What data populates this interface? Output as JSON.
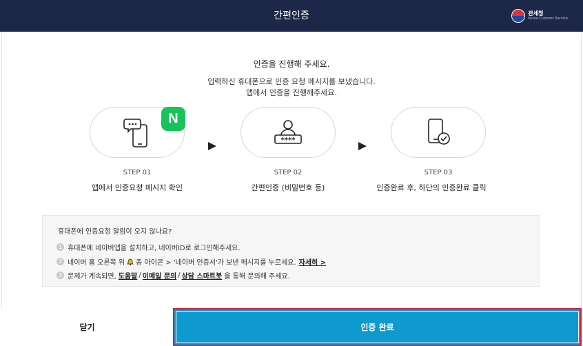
{
  "header": {
    "title": "간편인증",
    "logo_name": "관세청",
    "logo_sub": "Korea Customs Service"
  },
  "intro": {
    "title": "인증을 진행해 주세요.",
    "line1": "입력하신 휴대폰으로 인증 요청 메시지를 보냈습니다.",
    "line2": "앱에서 인증을 진행해주세요."
  },
  "steps": [
    {
      "label": "STEP 01",
      "desc": "앱에서 인증요청 메시지 확인",
      "icon": "phone-message-icon",
      "badge": "N"
    },
    {
      "label": "STEP 02",
      "desc": "간편인증 (비밀번호 등)",
      "icon": "user-password-icon"
    },
    {
      "label": "STEP 03",
      "desc": "인증완료 후, 하단의 인증완료 클릭",
      "icon": "phone-check-icon"
    }
  ],
  "help": {
    "title": "휴대폰에 인증요청 알림이 오지 않나요?",
    "row1": {
      "num": "1",
      "text": "휴대폰에 네이버앱을 설치하고, 네이버ID로 로그인해주세요."
    },
    "row2": {
      "num": "2",
      "text_a": "네이버 홈 오른쪽 위",
      "text_b": "종 아이콘 > '네이버 인증서'가 보낸 메시지를 누르세요.",
      "link": "자세히 >"
    },
    "row3": {
      "num": "3",
      "text_a": "문제가 계속되면,",
      "link1": "도움말",
      "sep1": "/",
      "link2": "이메일 문의",
      "sep2": "/",
      "link3": "상담 스마트봇",
      "text_b": "을 통해 문의해 주세요."
    }
  },
  "buttons": {
    "close": "닫기",
    "confirm": "인증 완료"
  },
  "colors": {
    "header_bg": "#1d2747",
    "confirm_bg": "#0e99cf",
    "highlight": "#d2233a",
    "naver": "#19c35b"
  }
}
